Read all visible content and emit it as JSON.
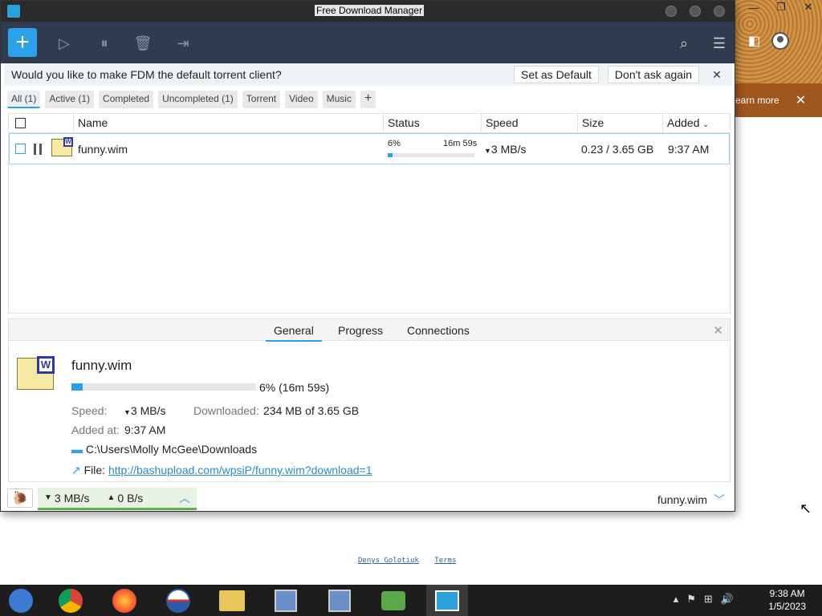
{
  "background_window": {
    "learn_more": "earn more"
  },
  "footer_links": [
    "Denys Golotiuk",
    "Terms"
  ],
  "window": {
    "title": "Free Download Manager"
  },
  "notice": {
    "message": "Would you like to make FDM the default torrent client?",
    "set_default": "Set as Default",
    "dont_ask": "Don't ask again",
    "close": "✕"
  },
  "filters": [
    {
      "label": "All (1)",
      "active": true
    },
    {
      "label": "Active (1)"
    },
    {
      "label": "Completed"
    },
    {
      "label": "Uncompleted (1)"
    },
    {
      "label": "Torrent"
    },
    {
      "label": "Video"
    },
    {
      "label": "Music"
    }
  ],
  "columns": {
    "name": "Name",
    "status": "Status",
    "speed": "Speed",
    "size": "Size",
    "added": "Added"
  },
  "download": {
    "name": "funny.wim",
    "percent": "6%",
    "progress": 0.06,
    "remaining": "16m 59s",
    "speed": "3 MB/s",
    "size": "0.23 / 3.65 GB",
    "added": "9:37 AM"
  },
  "detail": {
    "tabs": [
      "General",
      "Progress",
      "Connections"
    ],
    "name": "funny.wim",
    "progress_text": "6% (16m 59s)",
    "speed_label": "Speed:",
    "speed_value": "3 MB/s",
    "downloaded_label": "Downloaded:",
    "downloaded_value": "234 MB of 3.65 GB",
    "added_label": "Added at:",
    "added_value": "9:37 AM",
    "folder": "C:\\Users\\Molly McGee\\Downloads",
    "file_label": "File:",
    "file_url": "http://bashupload.com/wpsiP/funny.wim?download=1"
  },
  "statusbar": {
    "down_speed": "3 MB/s",
    "up_speed": "0 B/s",
    "current_file": "funny.wim"
  },
  "taskbar": {
    "time": "9:38 AM",
    "date": "1/5/2023"
  },
  "colors": {
    "accent": "#2aa1e8",
    "toolbar": "#2f3b4f",
    "titlebar": "#2b2b2b"
  }
}
